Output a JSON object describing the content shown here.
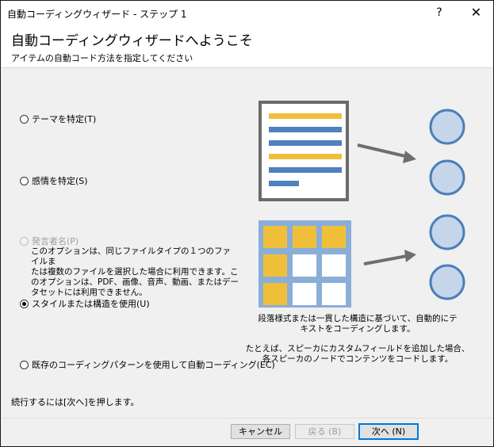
{
  "window": {
    "title": "自動コーディングウィザード - ステップ 1",
    "help_label": "?",
    "close_label": "✕"
  },
  "header": {
    "title": "自動コーディングウィザードへようこそ",
    "subtitle": "アイテムの自動コード方法を指定してください"
  },
  "options": [
    {
      "label": "テーマを特定(T)",
      "selected": false,
      "enabled": true
    },
    {
      "label": "感情を特定(S)",
      "selected": false,
      "enabled": true
    },
    {
      "label": "発言者名(P)",
      "selected": false,
      "enabled": false
    },
    {
      "label": "スタイルまたは構造を使用(U)",
      "selected": true,
      "enabled": true
    },
    {
      "label": "既存のコーディングパターンを使用して自動コーディング(EC)",
      "selected": false,
      "enabled": true
    }
  ],
  "speaker_note": {
    "line1": "このオプションは、同じファイルタイプの１つのファイルま",
    "line2": "たは複数のファイルを選択した場合に利用できます。こ",
    "line3": "のオプションは、PDF、画像、音声、動画、またはデー",
    "line4": "タセットには利用できません。"
  },
  "description": {
    "p1_line1": "段落様式または一貫した構造に基づいて、自動的にテ",
    "p1_line2": "キストをコーディングします。",
    "p2_line1": "たとえば、スピーカにカスタムフィールドを追加した場合、",
    "p2_line2": "各スピーカのノードでコンテンツをコードします。"
  },
  "footer_text": "続行するには[次へ]を押します。",
  "buttons": {
    "cancel": "キャンセル",
    "back": "戻る (B)",
    "next": "次へ (N)"
  },
  "colors": {
    "accent_blue": "#4f81bd",
    "yellow": "#f0bf3a",
    "node_fill": "#c5d5ea",
    "node_stroke": "#4a80b8",
    "grid_frame": "#8aaed8",
    "arrow": "#6e6e6e",
    "focus_border": "#0078d7"
  },
  "icons": [
    "help-icon",
    "close-icon",
    "document-illustration",
    "table-illustration",
    "arrow-icon",
    "node-circle-icon"
  ]
}
